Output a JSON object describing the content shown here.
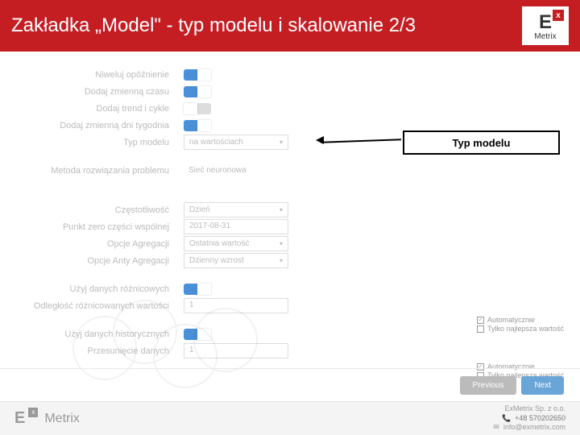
{
  "header": {
    "title": "Zakładka „Model\" - typ modelu i skalowanie 2/3",
    "logo_e": "E",
    "logo_x": "x",
    "logo_metrix": "Metrix"
  },
  "callout": {
    "label": "Typ modelu"
  },
  "rows": {
    "niweluj": {
      "label": "Niweluj opóźnienie"
    },
    "dodaj_czasu": {
      "label": "Dodaj zmienną czasu"
    },
    "dodaj_trend": {
      "label": "Dodaj trend i cykle"
    },
    "dodaj_dni": {
      "label": "Dodaj zmienną dni tygodnia"
    },
    "typ_modelu": {
      "label": "Typ modelu",
      "value": "na wartościach"
    },
    "metoda": {
      "label": "Metoda rozwiązania problemu",
      "value": "Sieć neuronowa"
    },
    "czestotliwosc": {
      "label": "Częstotliwość",
      "value": "Dzień"
    },
    "punkt_zero": {
      "label": "Punkt zero części wspólnej",
      "value": "2017-08-31"
    },
    "agregacja": {
      "label": "Opcje Agregacji",
      "value": "Ostatnia wartość"
    },
    "anty_agregacja": {
      "label": "Opcje Anty Agregacji",
      "value": "Dzienny wzrost"
    },
    "roznicowe": {
      "label": "Użyj danych różnicowych"
    },
    "odleglosc": {
      "label": "Odległość różnicowanych wartości",
      "value": "1"
    },
    "historyczne": {
      "label": "Użyj danych historycznych"
    },
    "przesuniecie": {
      "label": "Przesunięcie danych",
      "value": "1"
    }
  },
  "checks": {
    "auto": "Automatycznie",
    "tylko": "Tylko najlepsza wartość"
  },
  "nav": {
    "prev": "Previous",
    "next": "Next"
  },
  "footer": {
    "logo_e": "E",
    "logo_x": "x",
    "logo_metrix": "Metrix",
    "company": "ExMetrix Sp. z o.o.",
    "phone": "+48 570202650",
    "email": "info@exmetrix.com"
  }
}
